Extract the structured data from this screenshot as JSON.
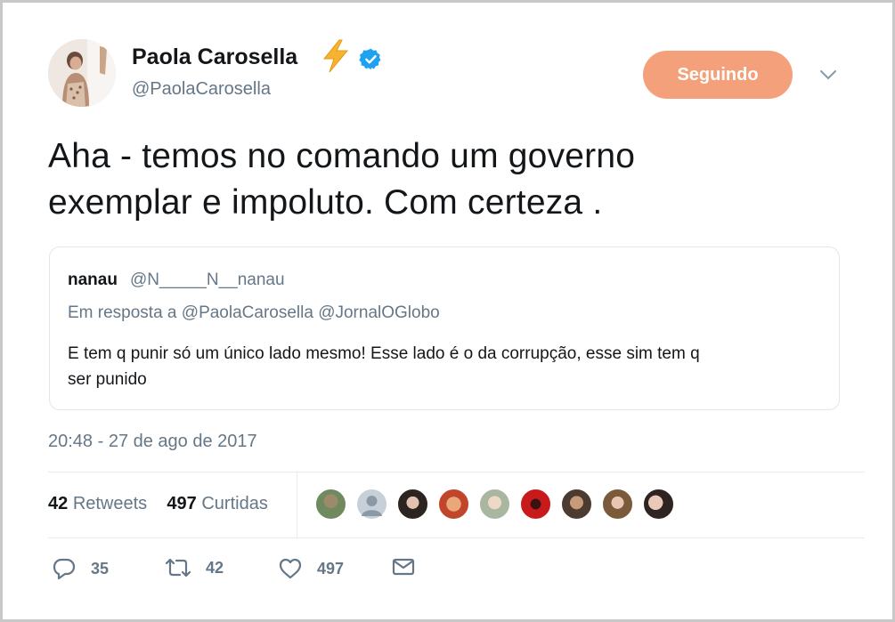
{
  "author": {
    "name": "Paola Carosella",
    "handle": "@PaolaCarosella",
    "emoji": "lightning-bolt",
    "verified": true
  },
  "follow_button": {
    "label": "Seguindo",
    "color": "#f4a07a"
  },
  "tweet": {
    "line1": "Aha - temos no comando um governo",
    "line2": "exemplar e impoluto. Com certeza ."
  },
  "quoted": {
    "name": "nanau",
    "handle": "@N_____N__nanau",
    "reply_to": "Em resposta a @PaolaCarosella @JornalOGlobo",
    "line1": "E tem q punir só um único lado mesmo! Esse lado é o da corrupção, esse sim tem q",
    "line2": "ser punido"
  },
  "timestamp": "20:48 - 27 de ago de 2017",
  "stats": {
    "retweets_count": "42",
    "retweets_label": "Retweets",
    "likes_count": "497",
    "likes_label": "Curtidas"
  },
  "liker_avatar_count": 9,
  "actions": {
    "reply_count": "35",
    "retweet_count": "42",
    "like_count": "497"
  },
  "colors": {
    "text": "#14171a",
    "secondary": "#657786",
    "verified": "#1da1f2",
    "border": "#e1e8ed"
  }
}
